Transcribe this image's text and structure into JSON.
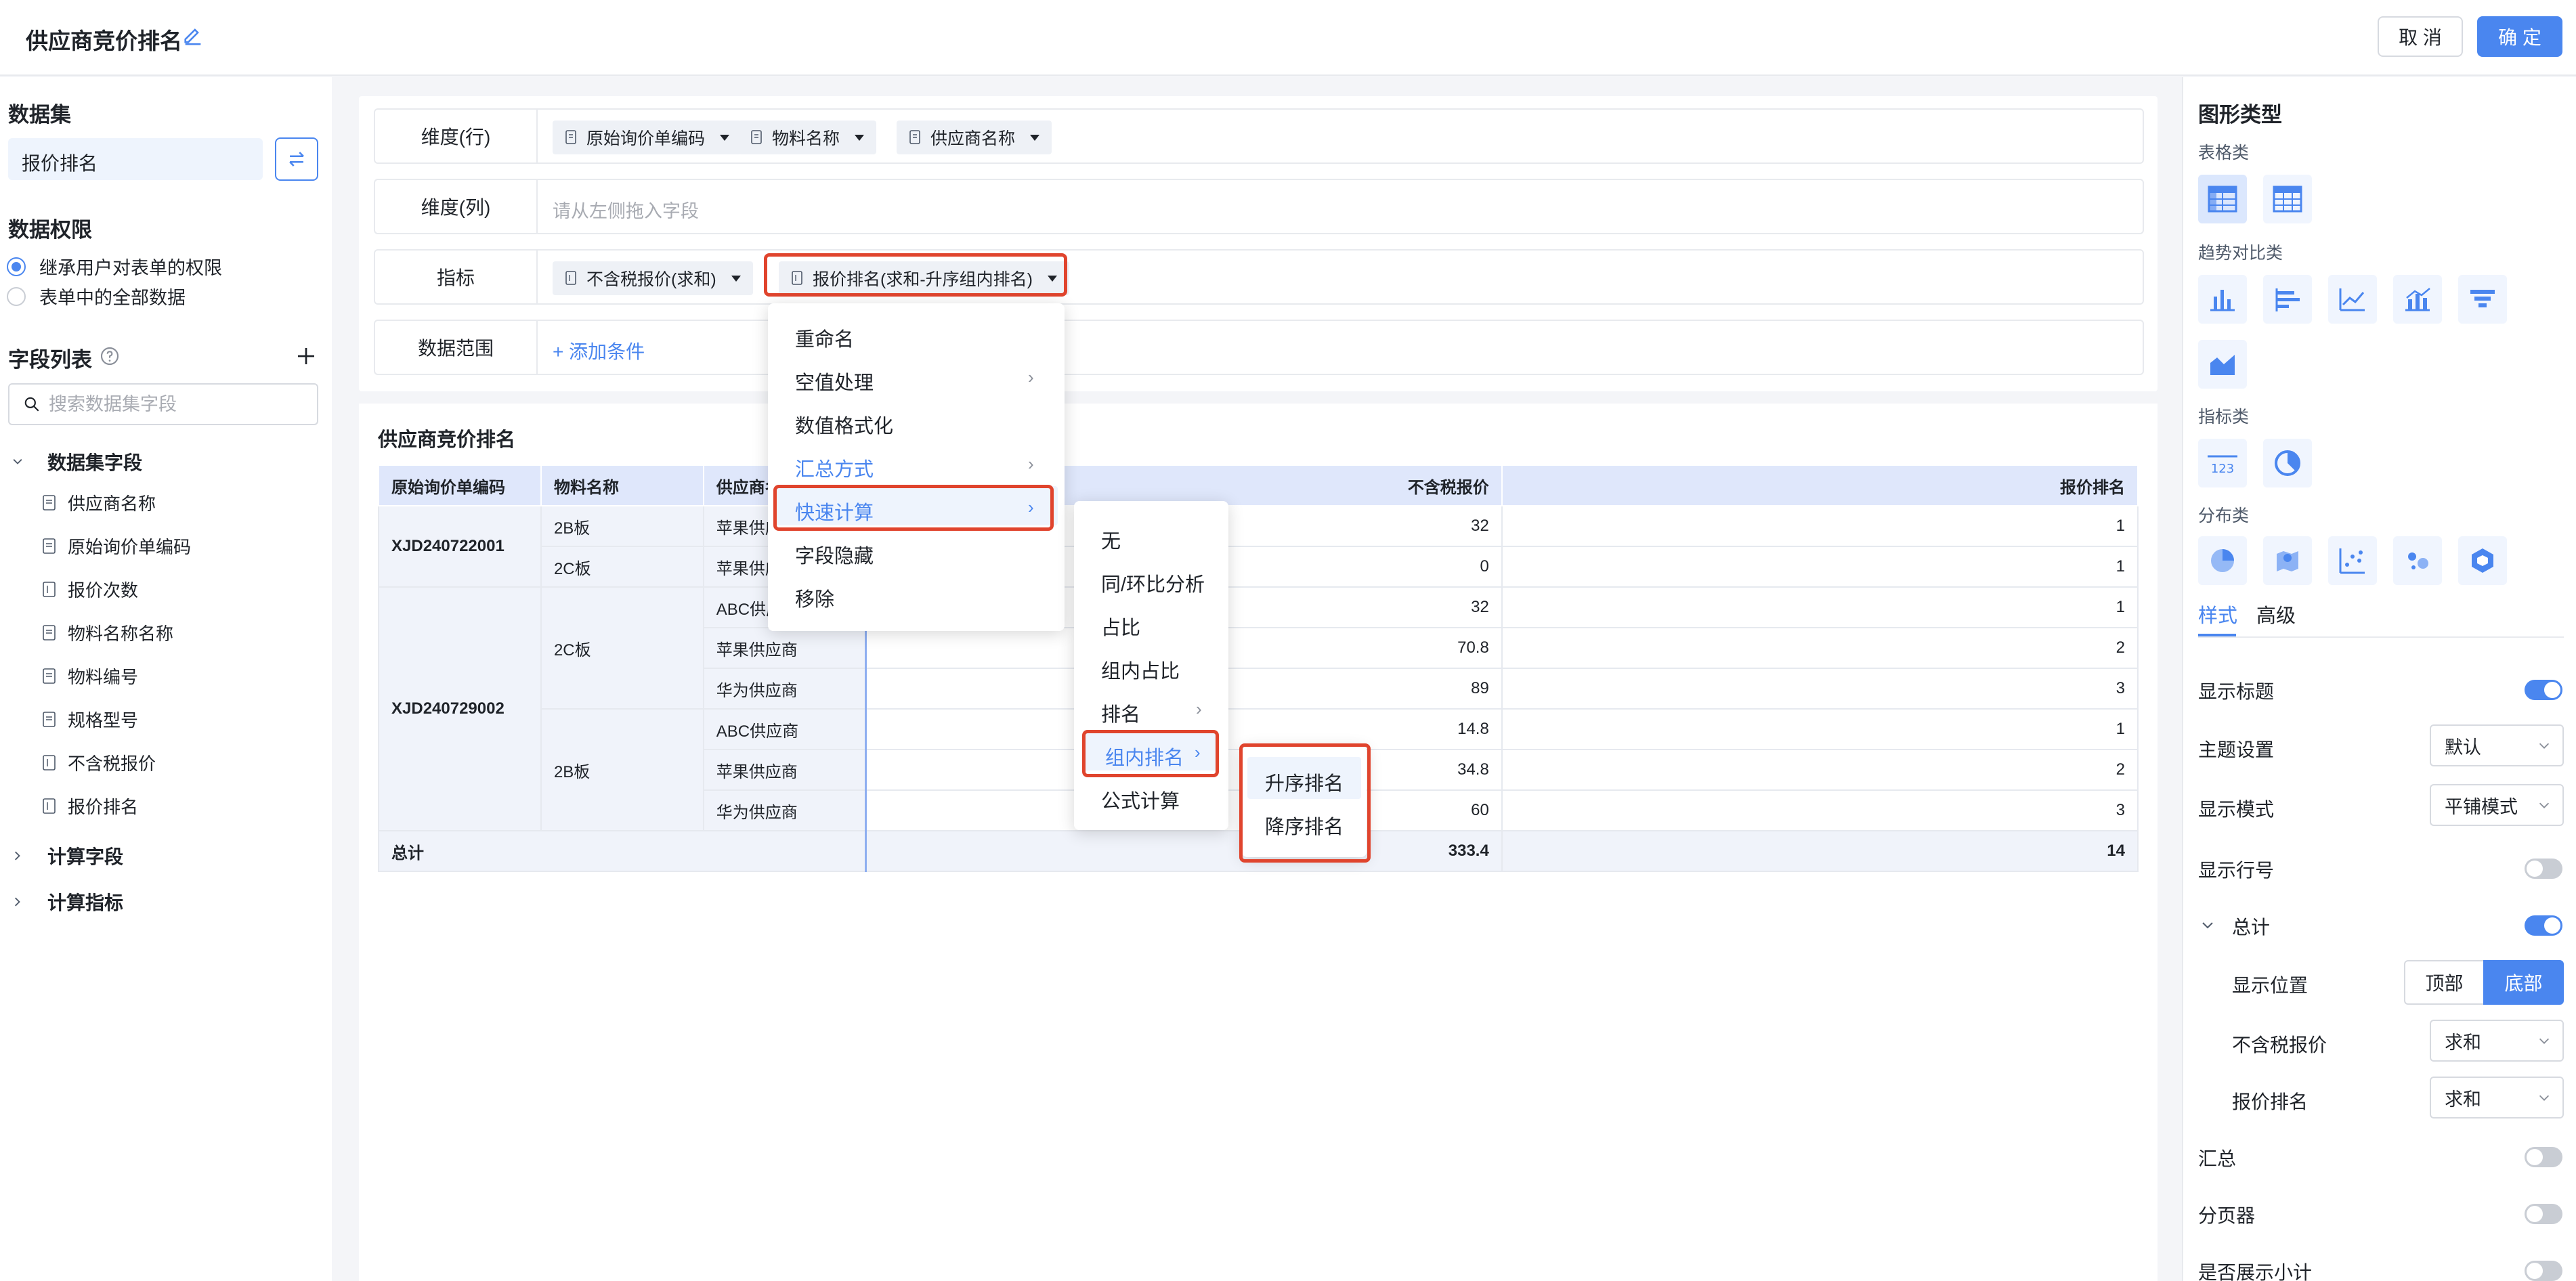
{
  "header": {
    "title": "供应商竞价排名",
    "cancel_label": "取 消",
    "ok_label": "确 定"
  },
  "left": {
    "dataset_title": "数据集",
    "dataset_name": "报价排名",
    "permission_title": "数据权限",
    "permission_options": [
      "继承用户对表单的权限",
      "表单中的全部数据"
    ],
    "field_list_title": "字段列表",
    "search_placeholder": "搜索数据集字段",
    "groups": [
      "数据集字段",
      "计算字段",
      "计算指标"
    ],
    "fields": [
      {
        "label": "供应商名称",
        "kind": "dim"
      },
      {
        "label": "原始询价单编码",
        "kind": "dim"
      },
      {
        "label": "报价次数",
        "kind": "measure"
      },
      {
        "label": "物料名称名称",
        "kind": "dim"
      },
      {
        "label": "物料编号",
        "kind": "dim"
      },
      {
        "label": "规格型号",
        "kind": "dim"
      },
      {
        "label": "不含税报价",
        "kind": "measure"
      },
      {
        "label": "报价排名",
        "kind": "measure"
      }
    ]
  },
  "config": {
    "rows_label": "维度(行)",
    "row_fields": [
      "原始询价单编码",
      "物料名称",
      "供应商名称"
    ],
    "cols_label": "维度(列)",
    "cols_placeholder": "请从左侧拖入字段",
    "measures_label": "指标",
    "measure_fields": [
      "不含税报价(求和)",
      "报价排名(求和-升序组内排名)"
    ],
    "range_label": "数据范围",
    "add_condition": "+ 添加条件"
  },
  "table": {
    "title": "供应商竞价排名",
    "headers": [
      "原始询价单编码",
      "物料名称",
      "供应商名称",
      "不含税报价",
      "报价排名"
    ],
    "groups": [
      {
        "code": "XJD240722001",
        "materials": [
          {
            "name": "2B板",
            "rows": [
              {
                "supplier": "苹果供应商",
                "price": "32",
                "rank": "1"
              }
            ]
          },
          {
            "name": "2C板",
            "rows": [
              {
                "supplier": "苹果供应商",
                "price": "0",
                "rank": "1"
              }
            ]
          }
        ]
      },
      {
        "code": "XJD240729002",
        "materials": [
          {
            "name": "2C板",
            "rows": [
              {
                "supplier": "ABC供应商",
                "price": "32",
                "rank": "1"
              },
              {
                "supplier": "苹果供应商",
                "price": "70.8",
                "rank": "2"
              },
              {
                "supplier": "华为供应商",
                "price": "89",
                "rank": "3"
              }
            ]
          },
          {
            "name": "2B板",
            "rows": [
              {
                "supplier": "ABC供应商",
                "price": "14.8",
                "rank": "1"
              },
              {
                "supplier": "苹果供应商",
                "price": "34.8",
                "rank": "2"
              },
              {
                "supplier": "华为供应商",
                "price": "60",
                "rank": "3"
              }
            ]
          }
        ]
      }
    ],
    "total": {
      "label": "总计",
      "price": "333.4",
      "rank": "14"
    }
  },
  "menu1": [
    "重命名",
    "空值处理",
    "数值格式化",
    "汇总方式",
    "快速计算",
    "字段隐藏",
    "移除"
  ],
  "menu2": [
    "无",
    "同/环比分析",
    "占比",
    "组内占比",
    "排名",
    "组内排名",
    "公式计算"
  ],
  "menu3": [
    "升序排名",
    "降序排名"
  ],
  "right": {
    "chart_type_title": "图形类型",
    "categories": [
      "表格类",
      "趋势对比类",
      "指标类",
      "分布类"
    ],
    "tabs": [
      "样式",
      "高级"
    ],
    "show_title": "显示标题",
    "theme_label": "主题设置",
    "theme_value": "默认",
    "display_mode_label": "显示模式",
    "display_mode_value": "平铺模式",
    "show_row_num": "显示行号",
    "total_label": "总计",
    "position_label": "显示位置",
    "position_options": [
      "顶部",
      "底部"
    ],
    "price_label": "不含税报价",
    "price_agg": "求和",
    "rank_label": "报价排名",
    "rank_agg": "求和",
    "summary_label": "汇总",
    "pager_label": "分页器",
    "subtotal_label": "是否展示小计"
  },
  "colors": {
    "accent": "#4a86ef",
    "highlight": "#e0442d"
  }
}
